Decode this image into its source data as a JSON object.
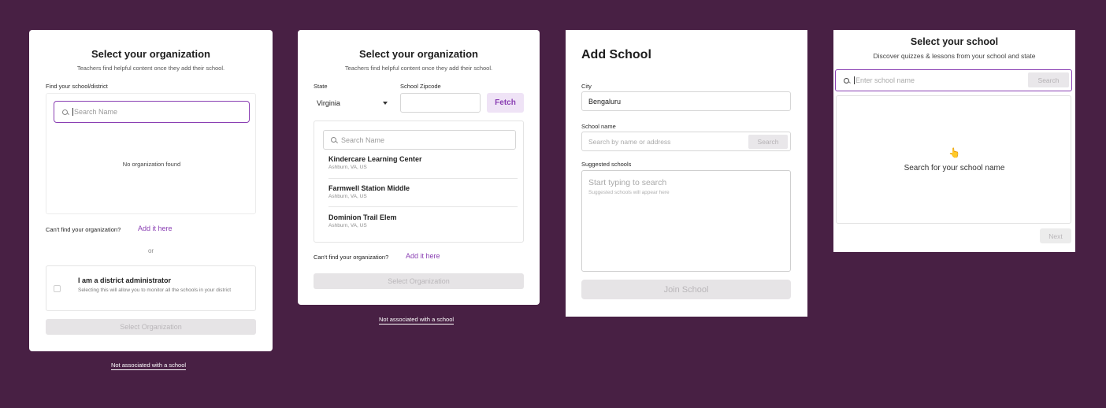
{
  "colors": {
    "background": "#482044",
    "accent": "#8a3fb3",
    "disabled_bg": "#e6e4e6"
  },
  "panel1": {
    "title": "Select your organization",
    "subtitle": "Teachers find helpful content once they add their school.",
    "find_label": "Find your school/district",
    "search_placeholder": "Search Name",
    "empty_text": "No organization found",
    "cant_find": "Can't find your organization?",
    "add_link": "Add it here",
    "or": "or",
    "admin_title": "I am a district administrator",
    "admin_desc": "Selecting this will allow you to monitor all the schools in your district",
    "select_button": "Select Organization",
    "not_associated": "Not associated with a school"
  },
  "panel2": {
    "title": "Select your organization",
    "subtitle": "Teachers find helpful content once they add their school.",
    "state_label": "State",
    "state_value": "Virginia",
    "zip_label": "School Zipcode",
    "zip_value": "",
    "fetch_button": "Fetch",
    "search_placeholder": "Search Name",
    "schools": [
      {
        "name": "Kindercare Learning Center",
        "address": "Ashburn, VA, US"
      },
      {
        "name": "Farmwell Station Middle",
        "address": "Ashburn, VA, US"
      },
      {
        "name": "Dominion Trail Elem",
        "address": "Ashburn, VA, US"
      }
    ],
    "cant_find": "Can't find your organization?",
    "add_link": "Add it here",
    "select_button": "Select Organization",
    "not_associated": "Not associated with a school"
  },
  "panel3": {
    "title": "Add School",
    "city_label": "City",
    "city_value": "Bengaluru",
    "school_label": "School name",
    "school_placeholder": "Search by name or address",
    "search_button": "Search",
    "suggested_label": "Suggested schools",
    "start_typing": "Start typing to search",
    "suggested_hint": "Suggested schools will appear here",
    "join_button": "Join School"
  },
  "panel4": {
    "title": "Select your school",
    "subtitle": "Discover quizzes & lessons from your school and state",
    "search_placeholder": "Enter school name",
    "search_button": "Search",
    "pointer_glyph": "👆",
    "empty_text": "Search for your school name",
    "next_button": "Next"
  }
}
